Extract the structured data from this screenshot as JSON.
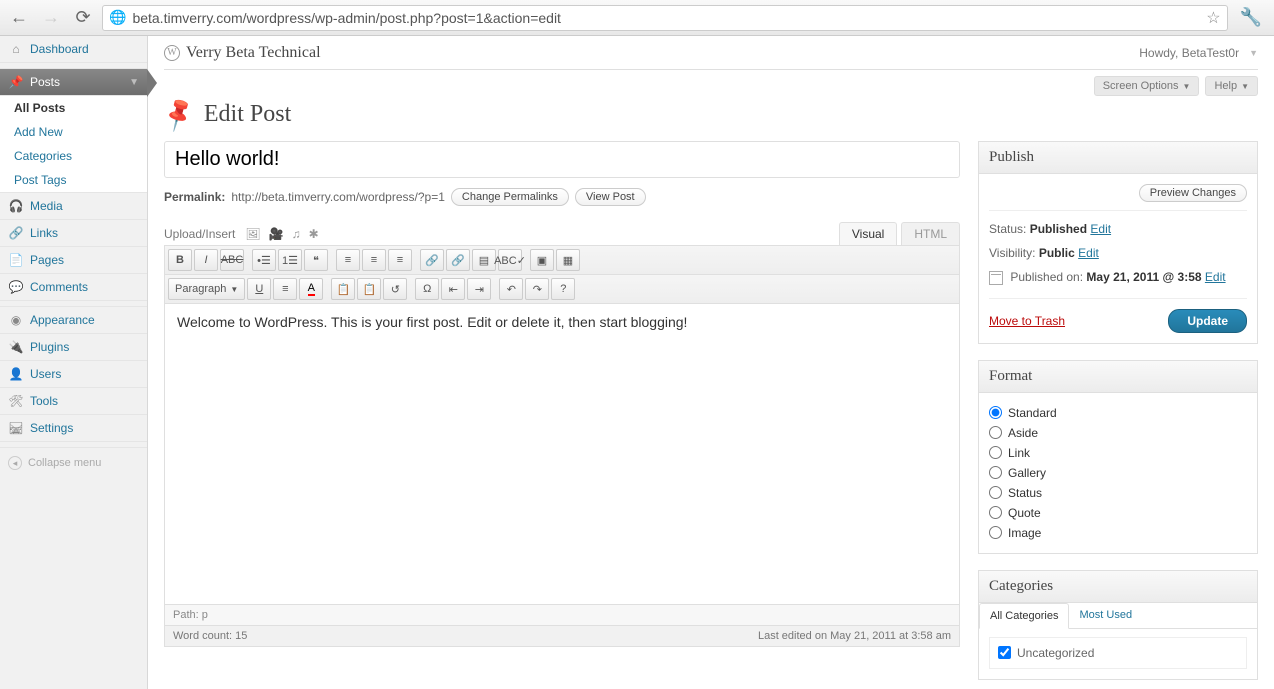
{
  "browser": {
    "url": "beta.timverry.com/wordpress/wp-admin/post.php?post=1&action=edit"
  },
  "topbar": {
    "site_title": "Verry Beta Technical",
    "howdy": "Howdy, BetaTest0r",
    "screen_options": "Screen Options",
    "help": "Help"
  },
  "sidebar": {
    "dashboard": "Dashboard",
    "posts": "Posts",
    "submenu": {
      "all_posts": "All Posts",
      "add_new": "Add New",
      "categories": "Categories",
      "post_tags": "Post Tags"
    },
    "media": "Media",
    "links": "Links",
    "pages": "Pages",
    "comments": "Comments",
    "appearance": "Appearance",
    "plugins": "Plugins",
    "users": "Users",
    "tools": "Tools",
    "settings": "Settings",
    "collapse": "Collapse menu"
  },
  "page": {
    "heading": "Edit Post",
    "title_value": "Hello world!",
    "permalink_label": "Permalink:",
    "permalink_url": "http://beta.timverry.com/wordpress/?p=1",
    "change_permalinks": "Change Permalinks",
    "view_post": "View Post",
    "upload_insert": "Upload/Insert",
    "tab_visual": "Visual",
    "tab_html": "HTML",
    "format_select": "Paragraph",
    "body": "Welcome to WordPress. This is your first post. Edit or delete it, then start blogging!",
    "path_label": "Path: p",
    "word_count": "Word count: 15",
    "last_edited": "Last edited on May 21, 2011 at 3:58 am"
  },
  "publish": {
    "box_title": "Publish",
    "preview": "Preview Changes",
    "status_label": "Status:",
    "status_value": "Published",
    "visibility_label": "Visibility:",
    "visibility_value": "Public",
    "published_label": "Published on:",
    "published_value": "May 21, 2011 @ 3:58",
    "edit": "Edit",
    "trash": "Move to Trash",
    "update": "Update"
  },
  "format": {
    "box_title": "Format",
    "options": [
      "Standard",
      "Aside",
      "Link",
      "Gallery",
      "Status",
      "Quote",
      "Image"
    ],
    "selected": "Standard"
  },
  "categories": {
    "box_title": "Categories",
    "tab_all": "All Categories",
    "tab_used": "Most Used",
    "item": "Uncategorized"
  }
}
